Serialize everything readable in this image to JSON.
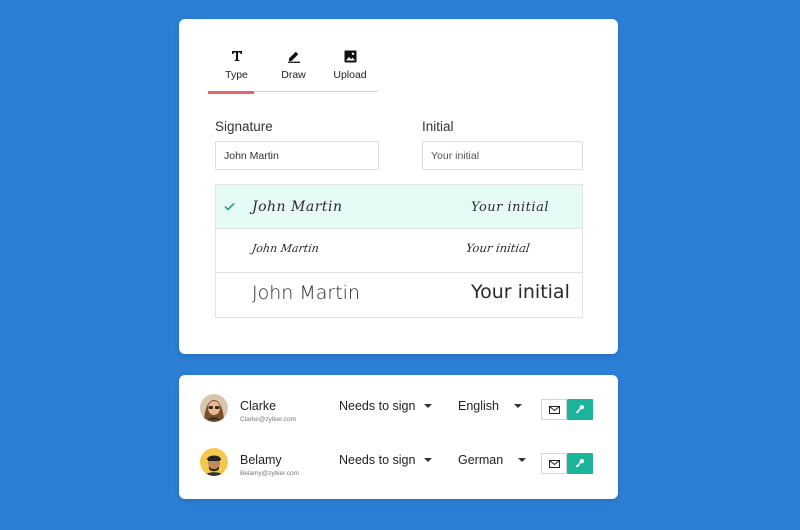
{
  "tabs": [
    {
      "label": "Type",
      "icon": "type-icon",
      "active": true
    },
    {
      "label": "Draw",
      "icon": "pen-icon",
      "active": false
    },
    {
      "label": "Upload",
      "icon": "image-icon",
      "active": false
    }
  ],
  "signature": {
    "label": "Signature",
    "value": "John Martin"
  },
  "initial": {
    "label": "Initial",
    "placeholder": "Your initial"
  },
  "styles": [
    {
      "signature": "John Martin",
      "initial": "Your initial",
      "selected": true
    },
    {
      "signature": "John Martin",
      "initial": "Your initial",
      "selected": false
    },
    {
      "signature": "John Martin",
      "initial": "Your initial",
      "selected": false
    }
  ],
  "signers": [
    {
      "name": "Clarke",
      "email": "Clarke@zylker.com",
      "role": "Needs to sign",
      "language": "English"
    },
    {
      "name": "Belamy",
      "email": "Belamy@zylker.com",
      "role": "Needs to sign",
      "language": "German"
    }
  ],
  "colors": {
    "background": "#2b7fd4",
    "tab_active_underline": "#e8626a",
    "selected_row": "#e6fbf5",
    "check": "#2aa382",
    "key_button": "#1bb39a"
  }
}
